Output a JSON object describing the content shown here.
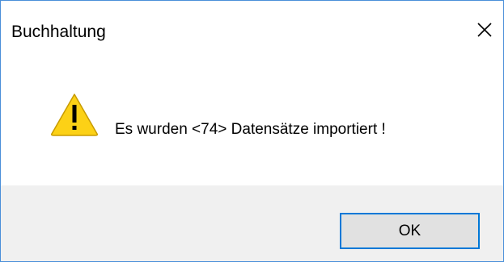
{
  "window": {
    "title": "Buchhaltung"
  },
  "message": {
    "text": "Es wurden <74> Datensätze importiert !",
    "icon": "warning-icon"
  },
  "buttons": {
    "ok_label": "OK"
  },
  "colors": {
    "accent": "#0078d7",
    "warning_fill": "#fcd116",
    "footer_bg": "#f0f0f0"
  }
}
